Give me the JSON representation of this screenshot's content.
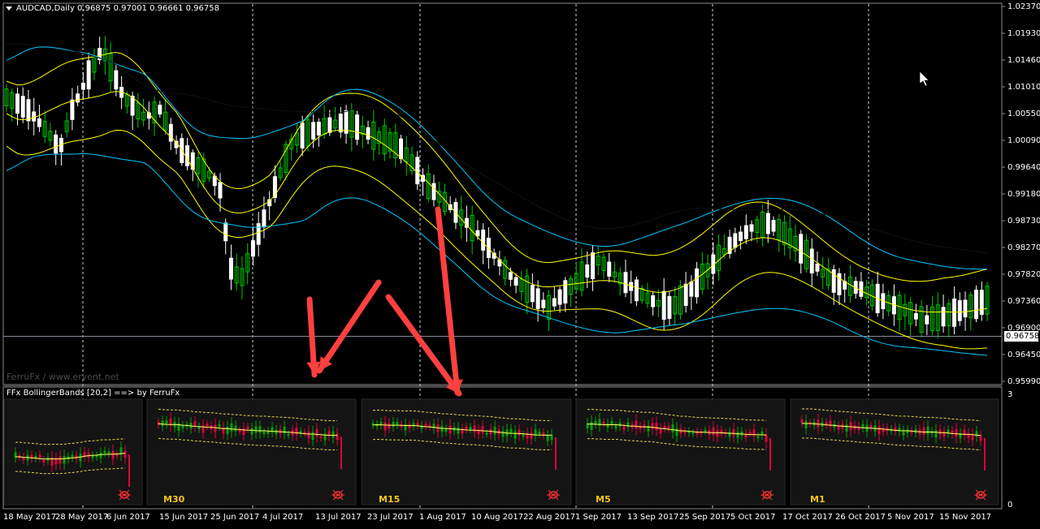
{
  "header": {
    "symbol_title": "AUDCAD,Daily  0.96875 0.97001 0.96661 0.96758"
  },
  "watermark": "FerruFx / www.ervent.net",
  "indicator": {
    "title": "FFx BollingerBands [20,2] ==> by FerruFx",
    "scale_max": "3",
    "scale_min": "0",
    "panels": [
      {
        "timeframe": ""
      },
      {
        "timeframe": "M30"
      },
      {
        "timeframe": "M15"
      },
      {
        "timeframe": "M5"
      },
      {
        "timeframe": "M1"
      }
    ]
  },
  "current_price": "0.96758",
  "price_axis": [
    "1.02370",
    "1.01930",
    "1.01460",
    "1.01010",
    "1.00550",
    "1.00090",
    "0.99640",
    "0.99180",
    "0.98730",
    "0.98270",
    "0.97820",
    "0.97360",
    "0.96900",
    "0.96450",
    "0.95990"
  ],
  "time_axis": [
    "18 May 2017",
    "28 May 2017",
    "6 Jun 2017",
    "15 Jun 2017",
    "25 Jun 2017",
    "4 Jul 2017",
    "13 Jul 2017",
    "23 Jul 2017",
    "1 Aug 2017",
    "10 Aug 2017",
    "22 Aug 2017",
    "1 Sep 2017",
    "13 Sep 2017",
    "25 Sep 2017",
    "5 Oct 2017",
    "17 Oct 2017",
    "26 Oct 2017",
    "5 Nov 2017",
    "15 Nov 2017"
  ],
  "colors": {
    "background": "#000000",
    "candle_up": "#00c800",
    "candle_down": "#ffffff",
    "band_outer": "#00c8ff",
    "band_mid": "#ffff00",
    "arrow": "#ff4040",
    "panel_bg": "#141414",
    "panel_up": "#00a000",
    "panel_down": "#e0003c",
    "timeframe_label": "#f5c518"
  },
  "icons": {
    "menu": "dropdown-triangle-icon",
    "cursor": "mouse-pointer-icon",
    "panel_badge": "bug-icon"
  }
}
